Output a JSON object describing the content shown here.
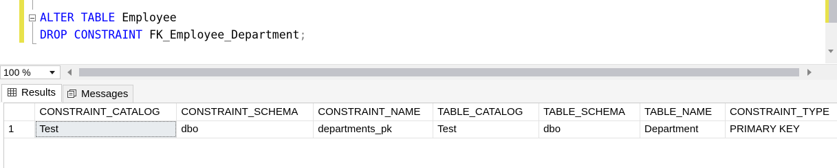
{
  "editor": {
    "lines": [
      {
        "keywords": "ALTER TABLE",
        "text": " Employee",
        "punct": ""
      },
      {
        "keywords": "DROP CONSTRAINT",
        "text": " FK_Employee_Department",
        "punct": ";"
      }
    ]
  },
  "zoom": {
    "value": "100 %"
  },
  "tabs": {
    "results_label": "Results",
    "messages_label": "Messages"
  },
  "grid": {
    "columns": [
      "",
      "CONSTRAINT_CATALOG",
      "CONSTRAINT_SCHEMA",
      "CONSTRAINT_NAME",
      "TABLE_CATALOG",
      "TABLE_SCHEMA",
      "TABLE_NAME",
      "CONSTRAINT_TYPE"
    ],
    "rows": [
      [
        "1",
        "Test",
        "dbo",
        "departments_pk",
        "Test",
        "dbo",
        "Department",
        "PRIMARY KEY"
      ]
    ]
  },
  "colors": {
    "keyword": "#0000ff",
    "change_marker": "#e8e24a"
  },
  "icons": [
    "grid-results-icon",
    "messages-icon",
    "chevron-down-icon",
    "scroll-left-icon",
    "scroll-right-icon",
    "collapse-icon"
  ]
}
